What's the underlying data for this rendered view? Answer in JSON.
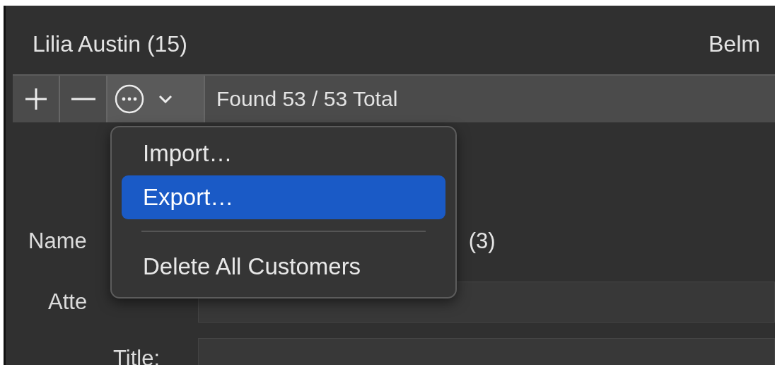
{
  "customer_list": {
    "rows": [
      {
        "name": "Lilia Austin (15)",
        "column_2": "Belm"
      }
    ]
  },
  "toolbar": {
    "buttons": [
      {
        "kind": "add"
      },
      {
        "kind": "remove"
      },
      {
        "kind": "more"
      }
    ],
    "status": "Found 53 / 53 Total"
  },
  "form": {
    "name_label": "Name",
    "name_suffix": "(3)",
    "attention_label": "Atte",
    "title_label": "Title:"
  },
  "menu": {
    "items": [
      {
        "kind": "item",
        "label": "Import…",
        "selected": false
      },
      {
        "kind": "item",
        "label": "Export…",
        "selected": true
      },
      {
        "kind": "separator"
      },
      {
        "kind": "item",
        "label": "Delete All Customers",
        "selected": false
      }
    ]
  }
}
